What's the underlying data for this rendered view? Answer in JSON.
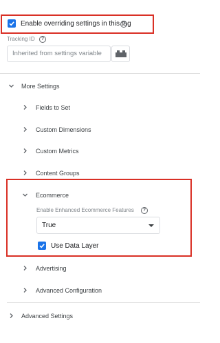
{
  "override": {
    "checkbox_label": "Enable overriding settings in this tag",
    "checked": true
  },
  "tracking": {
    "label": "Tracking ID",
    "placeholder": "Inherited from settings variable"
  },
  "more_settings": {
    "label": "More Settings",
    "items": [
      {
        "label": "Fields to Set"
      },
      {
        "label": "Custom Dimensions"
      },
      {
        "label": "Custom Metrics"
      },
      {
        "label": "Content Groups"
      }
    ]
  },
  "ecommerce": {
    "label": "Ecommerce",
    "features_label": "Enable Enhanced Ecommerce Features",
    "features_value": "True",
    "use_data_layer_label": "Use Data Layer",
    "use_data_layer_checked": true
  },
  "tail_items": [
    {
      "label": "Advertising"
    },
    {
      "label": "Advanced Configuration"
    }
  ],
  "advanced_settings": {
    "label": "Advanced Settings"
  },
  "icons": {
    "checkbox": "check-icon",
    "help": "question-circle-icon",
    "variable_picker": "variable-brick-icon",
    "expand": "chevron-right-icon",
    "collapse": "chevron-down-icon",
    "dropdown": "caret-down-icon"
  },
  "colors": {
    "accent": "#1a73e8",
    "highlight": "#d93025"
  }
}
